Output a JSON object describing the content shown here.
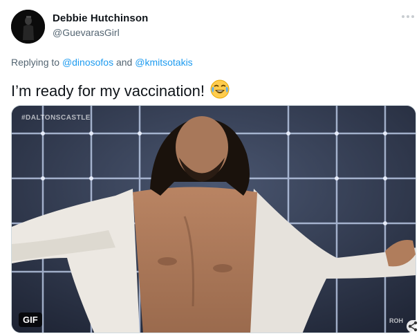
{
  "author": {
    "name": "Debbie Hutchinson",
    "handle": "@GuevarasGirl"
  },
  "reply": {
    "prefix": "Replying to ",
    "mention1": "@dinosofos",
    "conjunction": " and ",
    "mention2": "@kmitsotakis"
  },
  "tweet": {
    "text": "I’m ready for my vaccination!",
    "emoji": "😂"
  },
  "media": {
    "badge": "GIF",
    "watermark": "#DALTONSCASTLE",
    "corner_logo": "ROH"
  },
  "icons": {
    "more": "more-icon",
    "share": "share-icon"
  },
  "colors": {
    "link": "#1d9bf0",
    "secondary_text": "#536471",
    "primary_text": "#0f1419"
  }
}
